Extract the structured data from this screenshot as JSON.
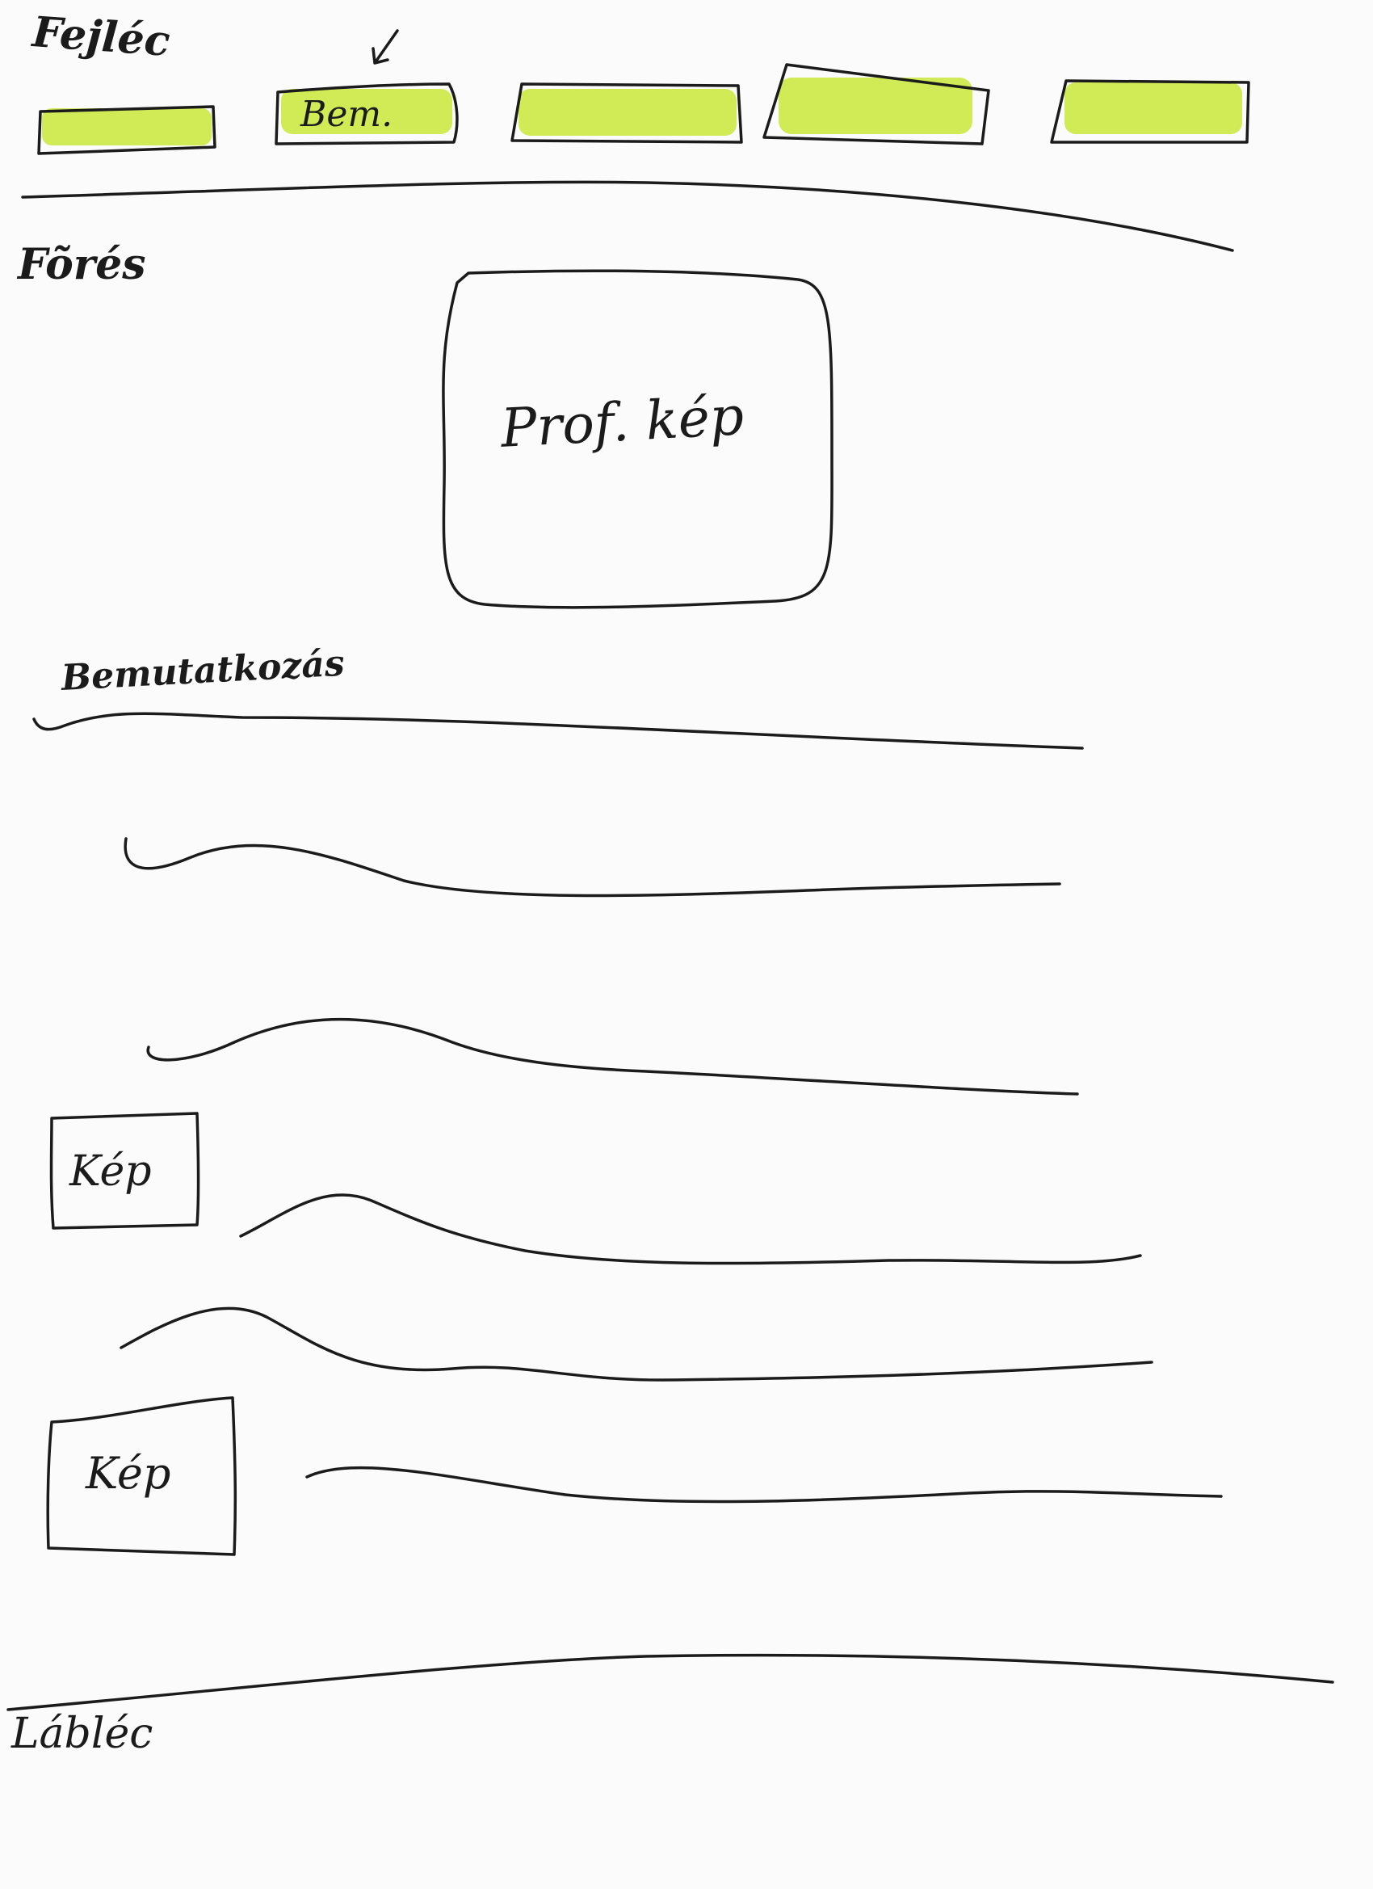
{
  "labels": {
    "header": "Fejléc",
    "main": "Fõrés",
    "footer": "Lábléc",
    "intro_section": "Bemutatkozás"
  },
  "nav": {
    "buttons": [
      {
        "label": ""
      },
      {
        "label": "Bem."
      },
      {
        "label": ""
      },
      {
        "label": ""
      },
      {
        "label": ""
      }
    ]
  },
  "placeholders": {
    "profile_image": "Prof. kép",
    "image_1": "Kép",
    "image_2": "Kép"
  },
  "colors": {
    "ink": "#1b1b1b",
    "highlight": "#c9e83a",
    "paper": "#fbfbfb"
  }
}
